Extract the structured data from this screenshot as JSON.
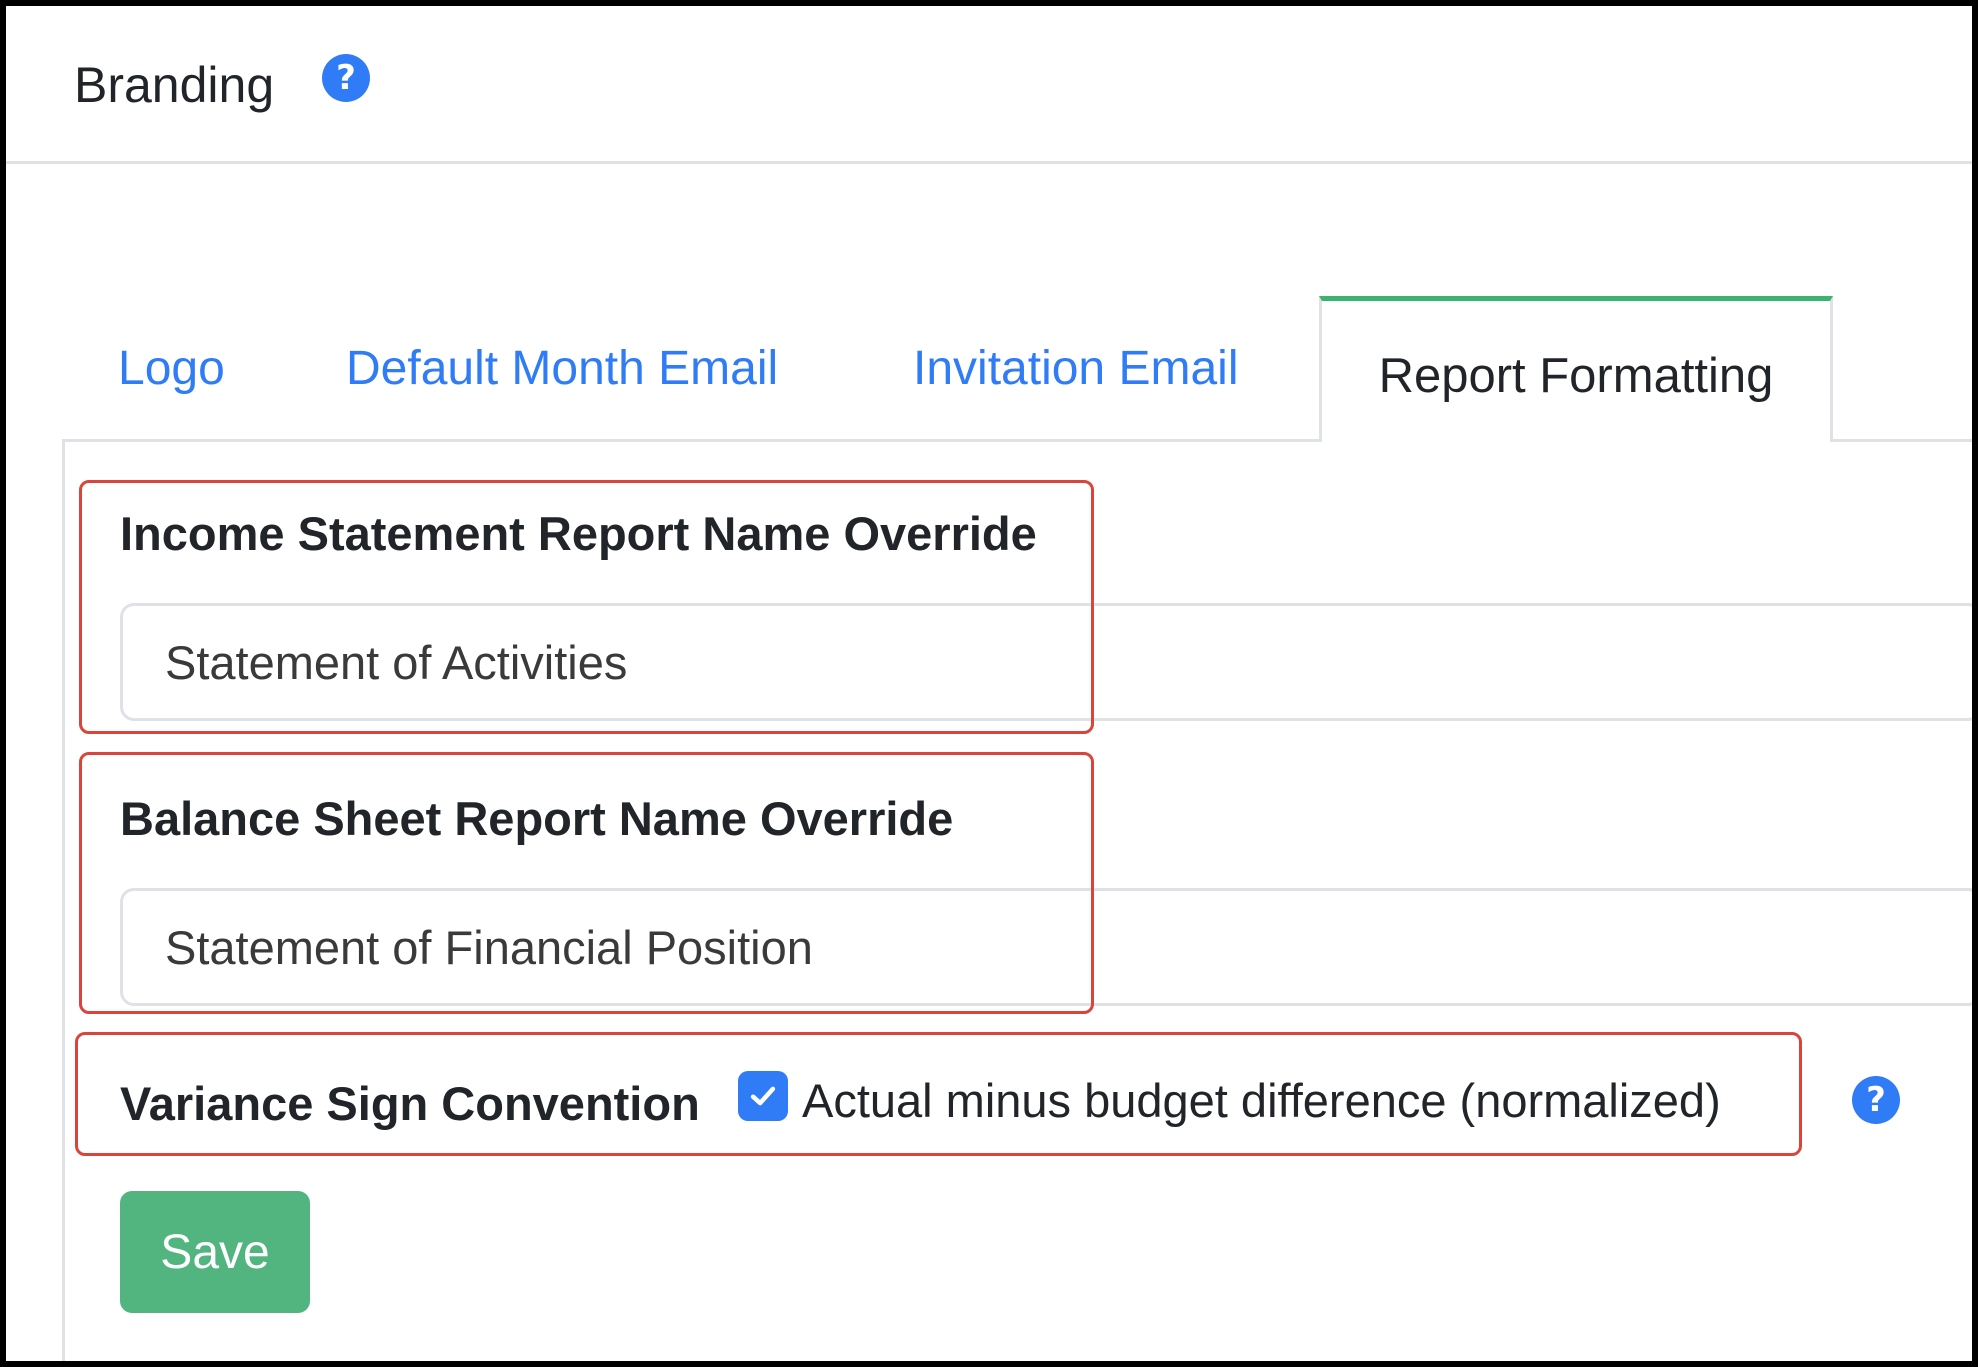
{
  "header": {
    "title": "Branding",
    "help_glyph": "?"
  },
  "tabs": [
    {
      "label": "Logo",
      "active": false
    },
    {
      "label": "Default Month Email",
      "active": false
    },
    {
      "label": "Invitation Email",
      "active": false
    },
    {
      "label": "Report Formatting",
      "active": true
    }
  ],
  "form": {
    "income_statement": {
      "label": "Income Statement Report Name Override",
      "value": "Statement of Activities"
    },
    "balance_sheet": {
      "label": "Balance Sheet Report Name Override",
      "value": "Statement of Financial Position"
    },
    "variance": {
      "label": "Variance Sign Convention",
      "checkbox_label": "Actual minus budget difference (normalized)",
      "checked": true,
      "help_glyph": "?"
    },
    "save_label": "Save"
  },
  "colors": {
    "link": "#2f7cf6",
    "active_tab_accent": "#3cb371",
    "save_button": "#52b57f",
    "highlight": "#d9453a",
    "help_icon": "#2f7cf6"
  },
  "icons": {
    "help": "question-circle-icon",
    "checkbox": "check-icon"
  }
}
